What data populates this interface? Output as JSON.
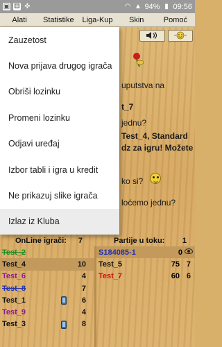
{
  "statusbar": {
    "battery": "94%",
    "time": "09:56"
  },
  "appbar": {
    "items": [
      "Alati",
      "Statistike",
      "Liga-Kup",
      "Skin",
      "Pomoć"
    ]
  },
  "background_chat": [
    "uputstva na",
    "t_7",
    "jednu?",
    "Test_4, Standard",
    "ǳ za igru! Možete",
    "ko si?",
    "lоćemo jednu?"
  ],
  "dropdown": {
    "items": [
      "Zauzetost",
      "Nova prijava drugog igrača",
      "Obriši lozinku",
      "Promeni lozinku",
      "Odjavi uređaj",
      "Izbor tabli i igra u kredit",
      "Ne prikazuj slike igrača",
      "Izlaz iz Kluba"
    ]
  },
  "online": {
    "title": "OnLine igrači:",
    "count": "7",
    "players": [
      {
        "name": "Test_2",
        "value": "",
        "color": "#1f8a1f",
        "strike": true,
        "phone": false,
        "highlight": false
      },
      {
        "name": "Test_4",
        "value": "10",
        "color": "#111111",
        "strike": false,
        "phone": false,
        "highlight": true
      },
      {
        "name": "Test_6",
        "value": "4",
        "color": "#8b1a8b",
        "strike": false,
        "phone": false,
        "highlight": false
      },
      {
        "name": "Test_8",
        "value": "7",
        "color": "#1e2fb0",
        "strike": true,
        "phone": false,
        "highlight": false
      },
      {
        "name": "Test_1",
        "value": "6",
        "color": "#111111",
        "strike": false,
        "phone": true,
        "highlight": false
      },
      {
        "name": "Test_9",
        "value": "4",
        "color": "#8b1a8b",
        "strike": false,
        "phone": false,
        "highlight": false
      },
      {
        "name": "Test_3",
        "value": "8",
        "color": "#111111",
        "strike": false,
        "phone": true,
        "highlight": false
      }
    ]
  },
  "games": {
    "title": "Partije u toku:",
    "count": "1",
    "rows": [
      {
        "name": "S184085-1",
        "a": "0",
        "b": "",
        "color": "#1e2fb0",
        "highlight": true,
        "eye": true
      },
      {
        "name": "Test_5",
        "a": "75",
        "b": "7",
        "color": "#111111",
        "highlight": false,
        "eye": false
      },
      {
        "name": "Test_7",
        "a": "60",
        "b": "6",
        "color": "#cc1111",
        "highlight": false,
        "eye": false
      }
    ]
  },
  "toolbar": {
    "sound_icon": "speaker-icon",
    "smiley_icon": "smiley-icon"
  }
}
